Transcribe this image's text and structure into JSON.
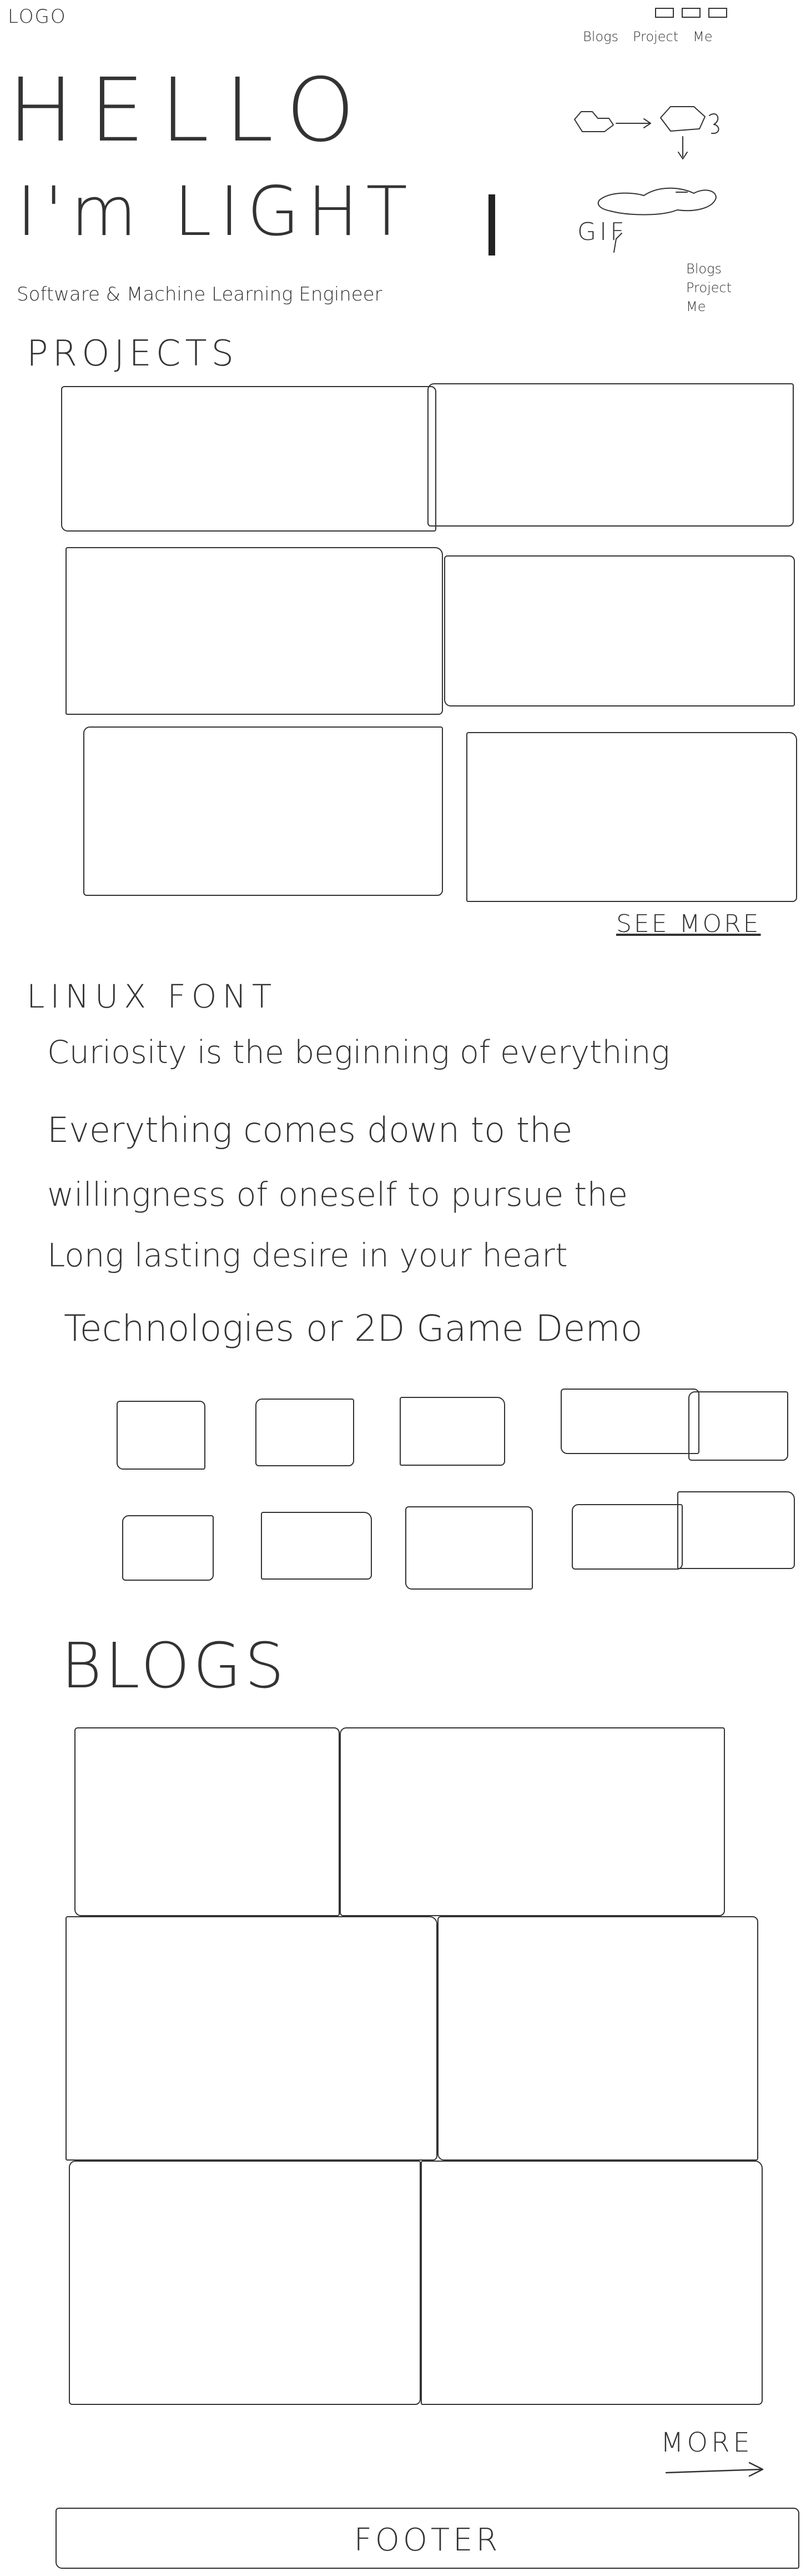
{
  "header": {
    "logo": "LOGO",
    "nav_links": [
      "Blogs",
      "Project",
      "Me"
    ]
  },
  "hero": {
    "greeting": "HELLO",
    "name_line": "I'm LIGHT",
    "cursor": "|",
    "subtitle": "Software & Machine Learning Engineer",
    "diagram_label": "GIF",
    "side_notes": [
      "Blogs",
      "Project",
      "Me"
    ]
  },
  "projects": {
    "heading": "PROJECTS",
    "cards": [
      "",
      "",
      "",
      "",
      "",
      ""
    ],
    "see_more": "SEE MORE"
  },
  "quote": {
    "font_label": "LINUX FONT",
    "lines": [
      "Curiosity is the beginning of everything",
      "Everything comes down to the",
      "willingness of oneself to pursue the",
      "Long lasting desire in your heart"
    ]
  },
  "technologies": {
    "heading": "Technologies or 2D Game Demo",
    "row1": [
      "",
      "",
      "",
      "",
      ""
    ],
    "row2": [
      "",
      "",
      "",
      "",
      ""
    ]
  },
  "blogs": {
    "heading": "BLOGS",
    "cards": [
      "",
      "",
      "",
      "",
      "",
      ""
    ],
    "more": "MORE"
  },
  "footer": {
    "label": "FOOTER"
  },
  "icons": {
    "arrow": "arrow-right-icon",
    "cursor": "text-cursor-icon"
  }
}
